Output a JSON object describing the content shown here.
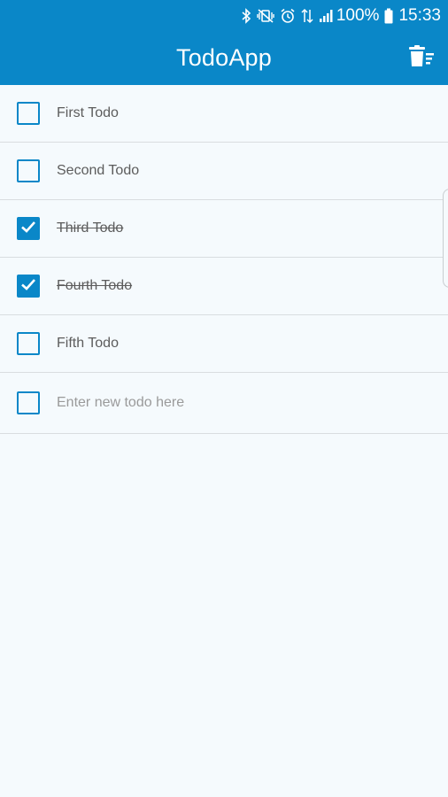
{
  "status_bar": {
    "battery_percent": "100%",
    "time": "15:33",
    "icons": [
      "bluetooth-icon",
      "vibrate-mute-icon",
      "alarm-icon",
      "data-4g-icon",
      "signal-icon",
      "battery-icon"
    ]
  },
  "app_bar": {
    "title": "TodoApp",
    "action_icon": "clear-completed-icon"
  },
  "todos": [
    {
      "text": "First Todo",
      "done": false
    },
    {
      "text": "Second Todo",
      "done": false
    },
    {
      "text": "Third Todo",
      "done": true
    },
    {
      "text": "Fourth Todo",
      "done": true
    },
    {
      "text": "Fifth Todo",
      "done": false
    }
  ],
  "new_todo": {
    "placeholder": "Enter new todo here",
    "value": ""
  },
  "colors": {
    "primary": "#0a87c8",
    "background": "#f5fafd",
    "divider": "#d9dde0",
    "text": "#5c5c5c"
  }
}
